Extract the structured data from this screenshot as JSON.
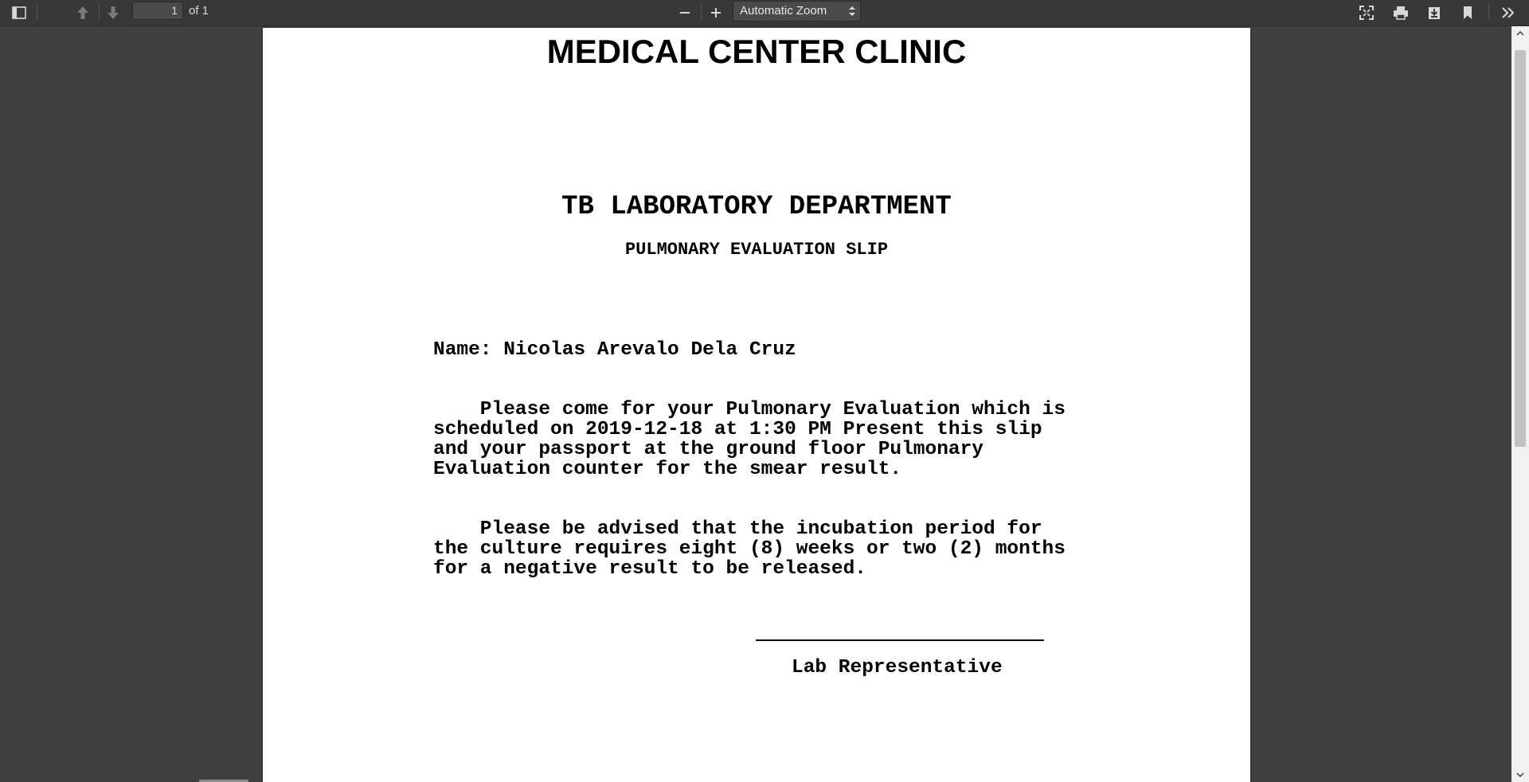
{
  "toolbar": {
    "page_number": "1",
    "page_count_text": "of 1",
    "zoom_value": "Automatic Zoom",
    "icons": [
      "sidebar-toggle-icon",
      "previous-page-icon",
      "next-page-icon",
      "zoom-out-icon",
      "zoom-in-icon",
      "presentation-mode-icon",
      "print-icon",
      "download-icon",
      "bookmark-icon",
      "tools-icon"
    ]
  },
  "document": {
    "title": "MEDICAL CENTER CLINIC",
    "department": "TB LABORATORY DEPARTMENT",
    "slip_title": "PULMONARY EVALUATION SLIP",
    "name_line": "Name: Nicolas Arevalo Dela Cruz",
    "paragraph1": [
      "    Please come for your Pulmonary Evaluation which is",
      "scheduled on 2019-12-18 at 1:30 PM Present this slip",
      "and your passport at the ground floor Pulmonary",
      "Evaluation counter for the smear result."
    ],
    "paragraph2": [
      "    Please be advised that the incubation period for",
      "the culture requires eight (8) weeks or two (2) months",
      "for a negative result to be released."
    ],
    "signature_label": "Lab Representative"
  },
  "colors": {
    "toolbar_bg": "#383838",
    "viewer_bg": "#404040",
    "page_bg": "#ffffff"
  }
}
